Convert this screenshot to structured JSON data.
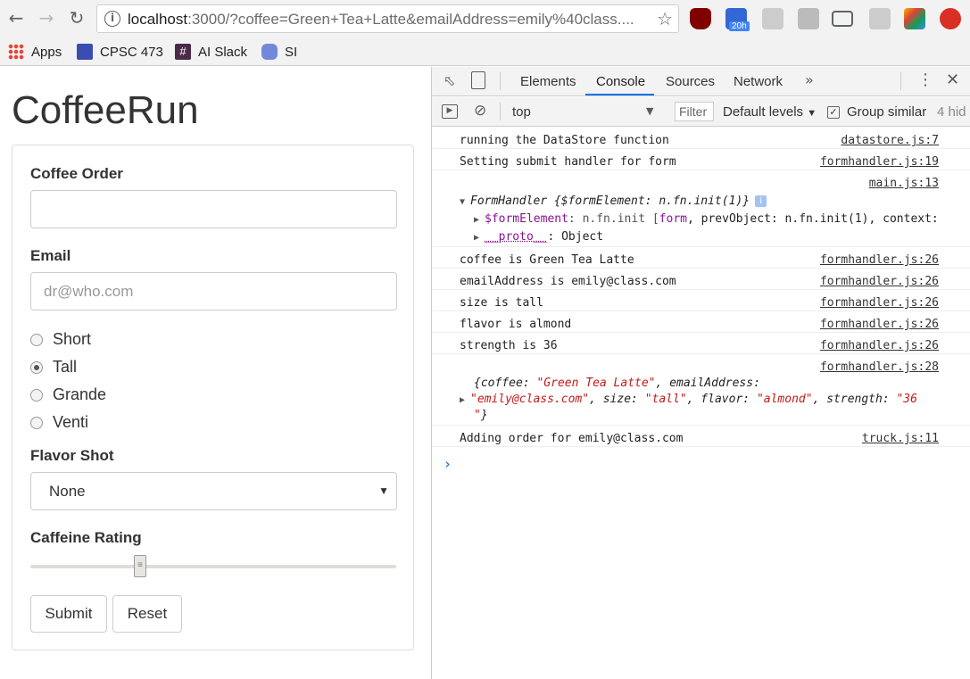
{
  "browser": {
    "url_host": "localhost",
    "url_rest": ":3000/?coffee=Green+Tea+Latte&emailAddress=emily%40class....",
    "badge_count": "20h",
    "bookmarks": [
      {
        "label": "Apps"
      },
      {
        "label": "CPSC 473"
      },
      {
        "label": "AI Slack"
      },
      {
        "label": "SI"
      }
    ]
  },
  "page": {
    "title": "CoffeeRun",
    "coffee_label": "Coffee Order",
    "coffee_value": "",
    "email_label": "Email",
    "email_placeholder": "dr@who.com",
    "sizes": [
      {
        "label": "Short",
        "checked": false
      },
      {
        "label": "Tall",
        "checked": true
      },
      {
        "label": "Grande",
        "checked": false
      },
      {
        "label": "Venti",
        "checked": false
      }
    ],
    "flavor_label": "Flavor Shot",
    "flavor_selected": "None",
    "caffeine_label": "Caffeine Rating",
    "caffeine_value": 30,
    "caffeine_range": [
      0,
      100
    ],
    "submit_label": "Submit",
    "reset_label": "Reset"
  },
  "devtools": {
    "tabs": [
      "Elements",
      "Console",
      "Sources",
      "Network"
    ],
    "active_tab": "Console",
    "context": "top",
    "filter_placeholder": "Filter",
    "levels": "Default levels",
    "group_similar": "Group similar",
    "hidden": "4 hid",
    "messages": [
      {
        "text": "running the DataStore function",
        "source": "datastore.js:7"
      },
      {
        "text": "Setting submit handler for form",
        "source": "formhandler.js:19"
      },
      {
        "source": "main.js:13",
        "object_head": "FormHandler",
        "object_preview": "{$formElement: n.fn.init(1)}",
        "child1_key": "$formElement",
        "child1_val": ": n.fn.init [",
        "child1_el": "form",
        "child1_rest": ", prevObject: n.fn.init(1), context:",
        "child2_key": "__proto__",
        "child2_val": ": Object"
      },
      {
        "text": "coffee is Green Tea Latte",
        "source": "formhandler.js:26"
      },
      {
        "text": "emailAddress is emily@class.com",
        "source": "formhandler.js:26"
      },
      {
        "text": "size is tall",
        "source": "formhandler.js:26"
      },
      {
        "text": "flavor is almond",
        "source": "formhandler.js:26"
      },
      {
        "text": "strength is 36",
        "source": "formhandler.js:26"
      },
      {
        "source": "formhandler.js:28",
        "l1a": "{coffee: ",
        "l1b": "\"Green Tea Latte\"",
        "l1c": ", emailAddress:",
        "l2a": "\"emily@class.com\"",
        "l2b": ", size: ",
        "l2c": "\"tall\"",
        "l2d": ", flavor: ",
        "l2e": "\"almond\"",
        "l2f": ", strength: ",
        "l2g": "\"36",
        "l3a": "\"",
        "l3b": "}"
      },
      {
        "text": "Adding order for emily@class.com",
        "source": "truck.js:11"
      }
    ]
  }
}
